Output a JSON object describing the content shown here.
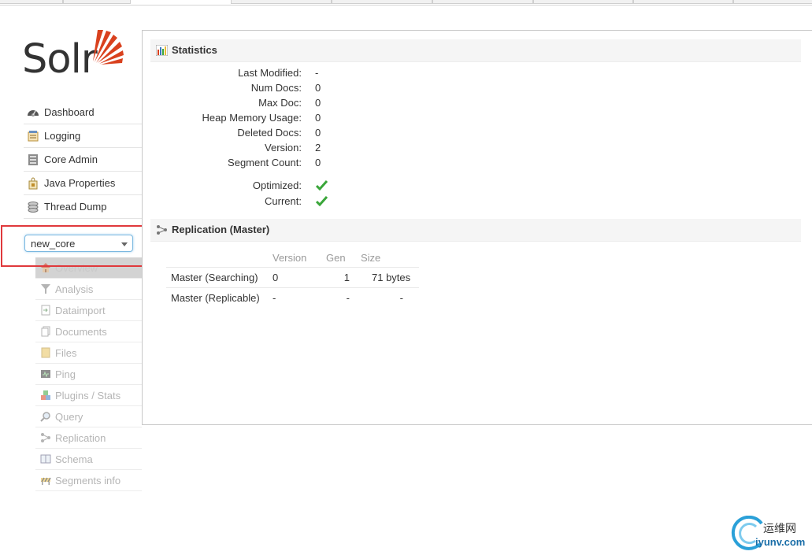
{
  "app": {
    "logo_text": "Solr"
  },
  "main_menu": [
    {
      "label": "Dashboard",
      "icon": "dashboard-icon"
    },
    {
      "label": "Logging",
      "icon": "logging-icon"
    },
    {
      "label": "Core Admin",
      "icon": "core-admin-icon"
    },
    {
      "label": "Java Properties",
      "icon": "java-properties-icon"
    },
    {
      "label": "Thread Dump",
      "icon": "thread-dump-icon"
    }
  ],
  "core_selector": {
    "value": "new_core"
  },
  "core_menu": [
    {
      "label": "Overview",
      "icon": "home-icon",
      "active": true
    },
    {
      "label": "Analysis",
      "icon": "funnel-icon"
    },
    {
      "label": "Dataimport",
      "icon": "dataimport-icon"
    },
    {
      "label": "Documents",
      "icon": "documents-icon"
    },
    {
      "label": "Files",
      "icon": "files-icon"
    },
    {
      "label": "Ping",
      "icon": "ping-icon"
    },
    {
      "label": "Plugins / Stats",
      "icon": "plugins-icon"
    },
    {
      "label": "Query",
      "icon": "query-icon"
    },
    {
      "label": "Replication",
      "icon": "replication-icon"
    },
    {
      "label": "Schema",
      "icon": "schema-icon"
    },
    {
      "label": "Segments info",
      "icon": "segments-icon"
    }
  ],
  "statistics": {
    "title": "Statistics",
    "rows": [
      {
        "label": "Last Modified:",
        "value": "-"
      },
      {
        "label": "Num Docs:",
        "value": "0"
      },
      {
        "label": "Max Doc:",
        "value": "0"
      },
      {
        "label": "Heap Memory Usage:",
        "value": "0"
      },
      {
        "label": "Deleted Docs:",
        "value": "0"
      },
      {
        "label": "Version:",
        "value": "2"
      },
      {
        "label": "Segment Count:",
        "value": "0"
      }
    ],
    "flags": [
      {
        "label": "Optimized:",
        "checked": true
      },
      {
        "label": "Current:",
        "checked": true
      }
    ]
  },
  "replication": {
    "title": "Replication (Master)",
    "columns": [
      "Version",
      "Gen",
      "Size"
    ],
    "rows": [
      {
        "name": "Master (Searching)",
        "version": "0",
        "gen": "1",
        "size": "71 bytes"
      },
      {
        "name": "Master (Replicable)",
        "version": "-",
        "gen": "-",
        "size": "-"
      }
    ]
  },
  "watermark": {
    "text_cn": "运维网",
    "text_url": "iyunv.com"
  },
  "colors": {
    "accent": "#d9411e",
    "check": "#3aa63a",
    "highlight": "#e0393c"
  }
}
